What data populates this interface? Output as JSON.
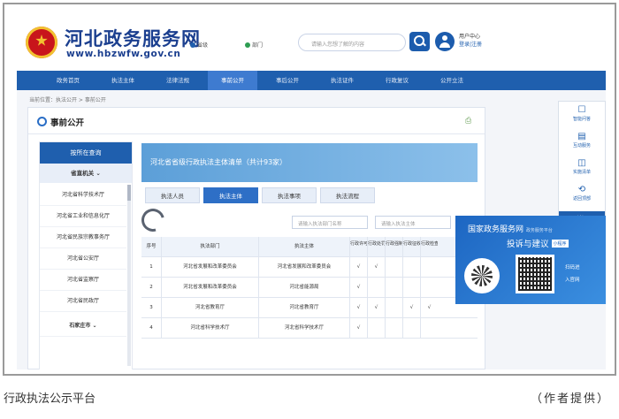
{
  "header": {
    "site_title": "河北政务服务网",
    "site_url": "www.hbzwfw.gov.cn",
    "location_city": "省级",
    "location_dept": "部门",
    "search_placeholder": "请输入您想了解的内容",
    "user_center": "用户中心",
    "login_register": "登录|注册"
  },
  "nav": {
    "items": [
      "政务首页",
      "执法主体",
      "法律法规",
      "事前公开",
      "事后公开",
      "执法证件",
      "行政复议",
      "公开立法"
    ],
    "active_index": 3
  },
  "breadcrumb": "当前位置：执法公开 > 事前公开",
  "panel": {
    "title": "事前公开",
    "left_menu": {
      "header": "按所在查询",
      "sub_header": "省直机关",
      "items": [
        "河北省科学技术厅",
        "河北省工业和信息化厅",
        "河北省民族宗教事务厅",
        "河北省公安厅",
        "河北省监察厅",
        "河北省民政厅",
        "石家庄市"
      ]
    },
    "banner_title": "河北省省级行政执法主体清单（共计93家）",
    "tabs": [
      "执法人员",
      "执法主体",
      "执法事项",
      "执法流程"
    ],
    "active_tab": 1,
    "search1_placeholder": "请输入执法部门名称",
    "search2_placeholder": "请输入执法主体",
    "table": {
      "headers": [
        "序号",
        "执法部门",
        "执法主体",
        "行政许可",
        "行政处罚",
        "行政强制",
        "行政征收",
        "行政检查"
      ],
      "rows": [
        [
          "1",
          "河北省发展和改革委员会",
          "河北省发展和改革委员会",
          "√",
          "√",
          "",
          "",
          ""
        ],
        [
          "2",
          "河北省发展和改革委员会",
          "河北省能源局",
          "√",
          "",
          "",
          "",
          ""
        ],
        [
          "3",
          "河北省教育厅",
          "河北省教育厅",
          "√",
          "√",
          "",
          "√",
          "√"
        ],
        [
          "4",
          "河北省科学技术厅",
          "河北省科学技术厅",
          "√",
          "",
          "",
          "",
          ""
        ]
      ]
    }
  },
  "right_sidebar": {
    "items": [
      {
        "icon": "☐",
        "label": "智能问答"
      },
      {
        "icon": "▤",
        "label": "互动服务"
      },
      {
        "icon": "◫",
        "label": "实施清单"
      },
      {
        "icon": "⟲",
        "label": "返回顶部"
      }
    ],
    "last_label": "关闭"
  },
  "service_card": {
    "line1": "国家政务服务网",
    "line1_small": "政务服务平台",
    "line2": "投诉与建议",
    "badge": "小程序",
    "side1": "扫码进",
    "side2": "入官网"
  },
  "caption": "行政执法公示平台",
  "credit": "（作者提供）"
}
